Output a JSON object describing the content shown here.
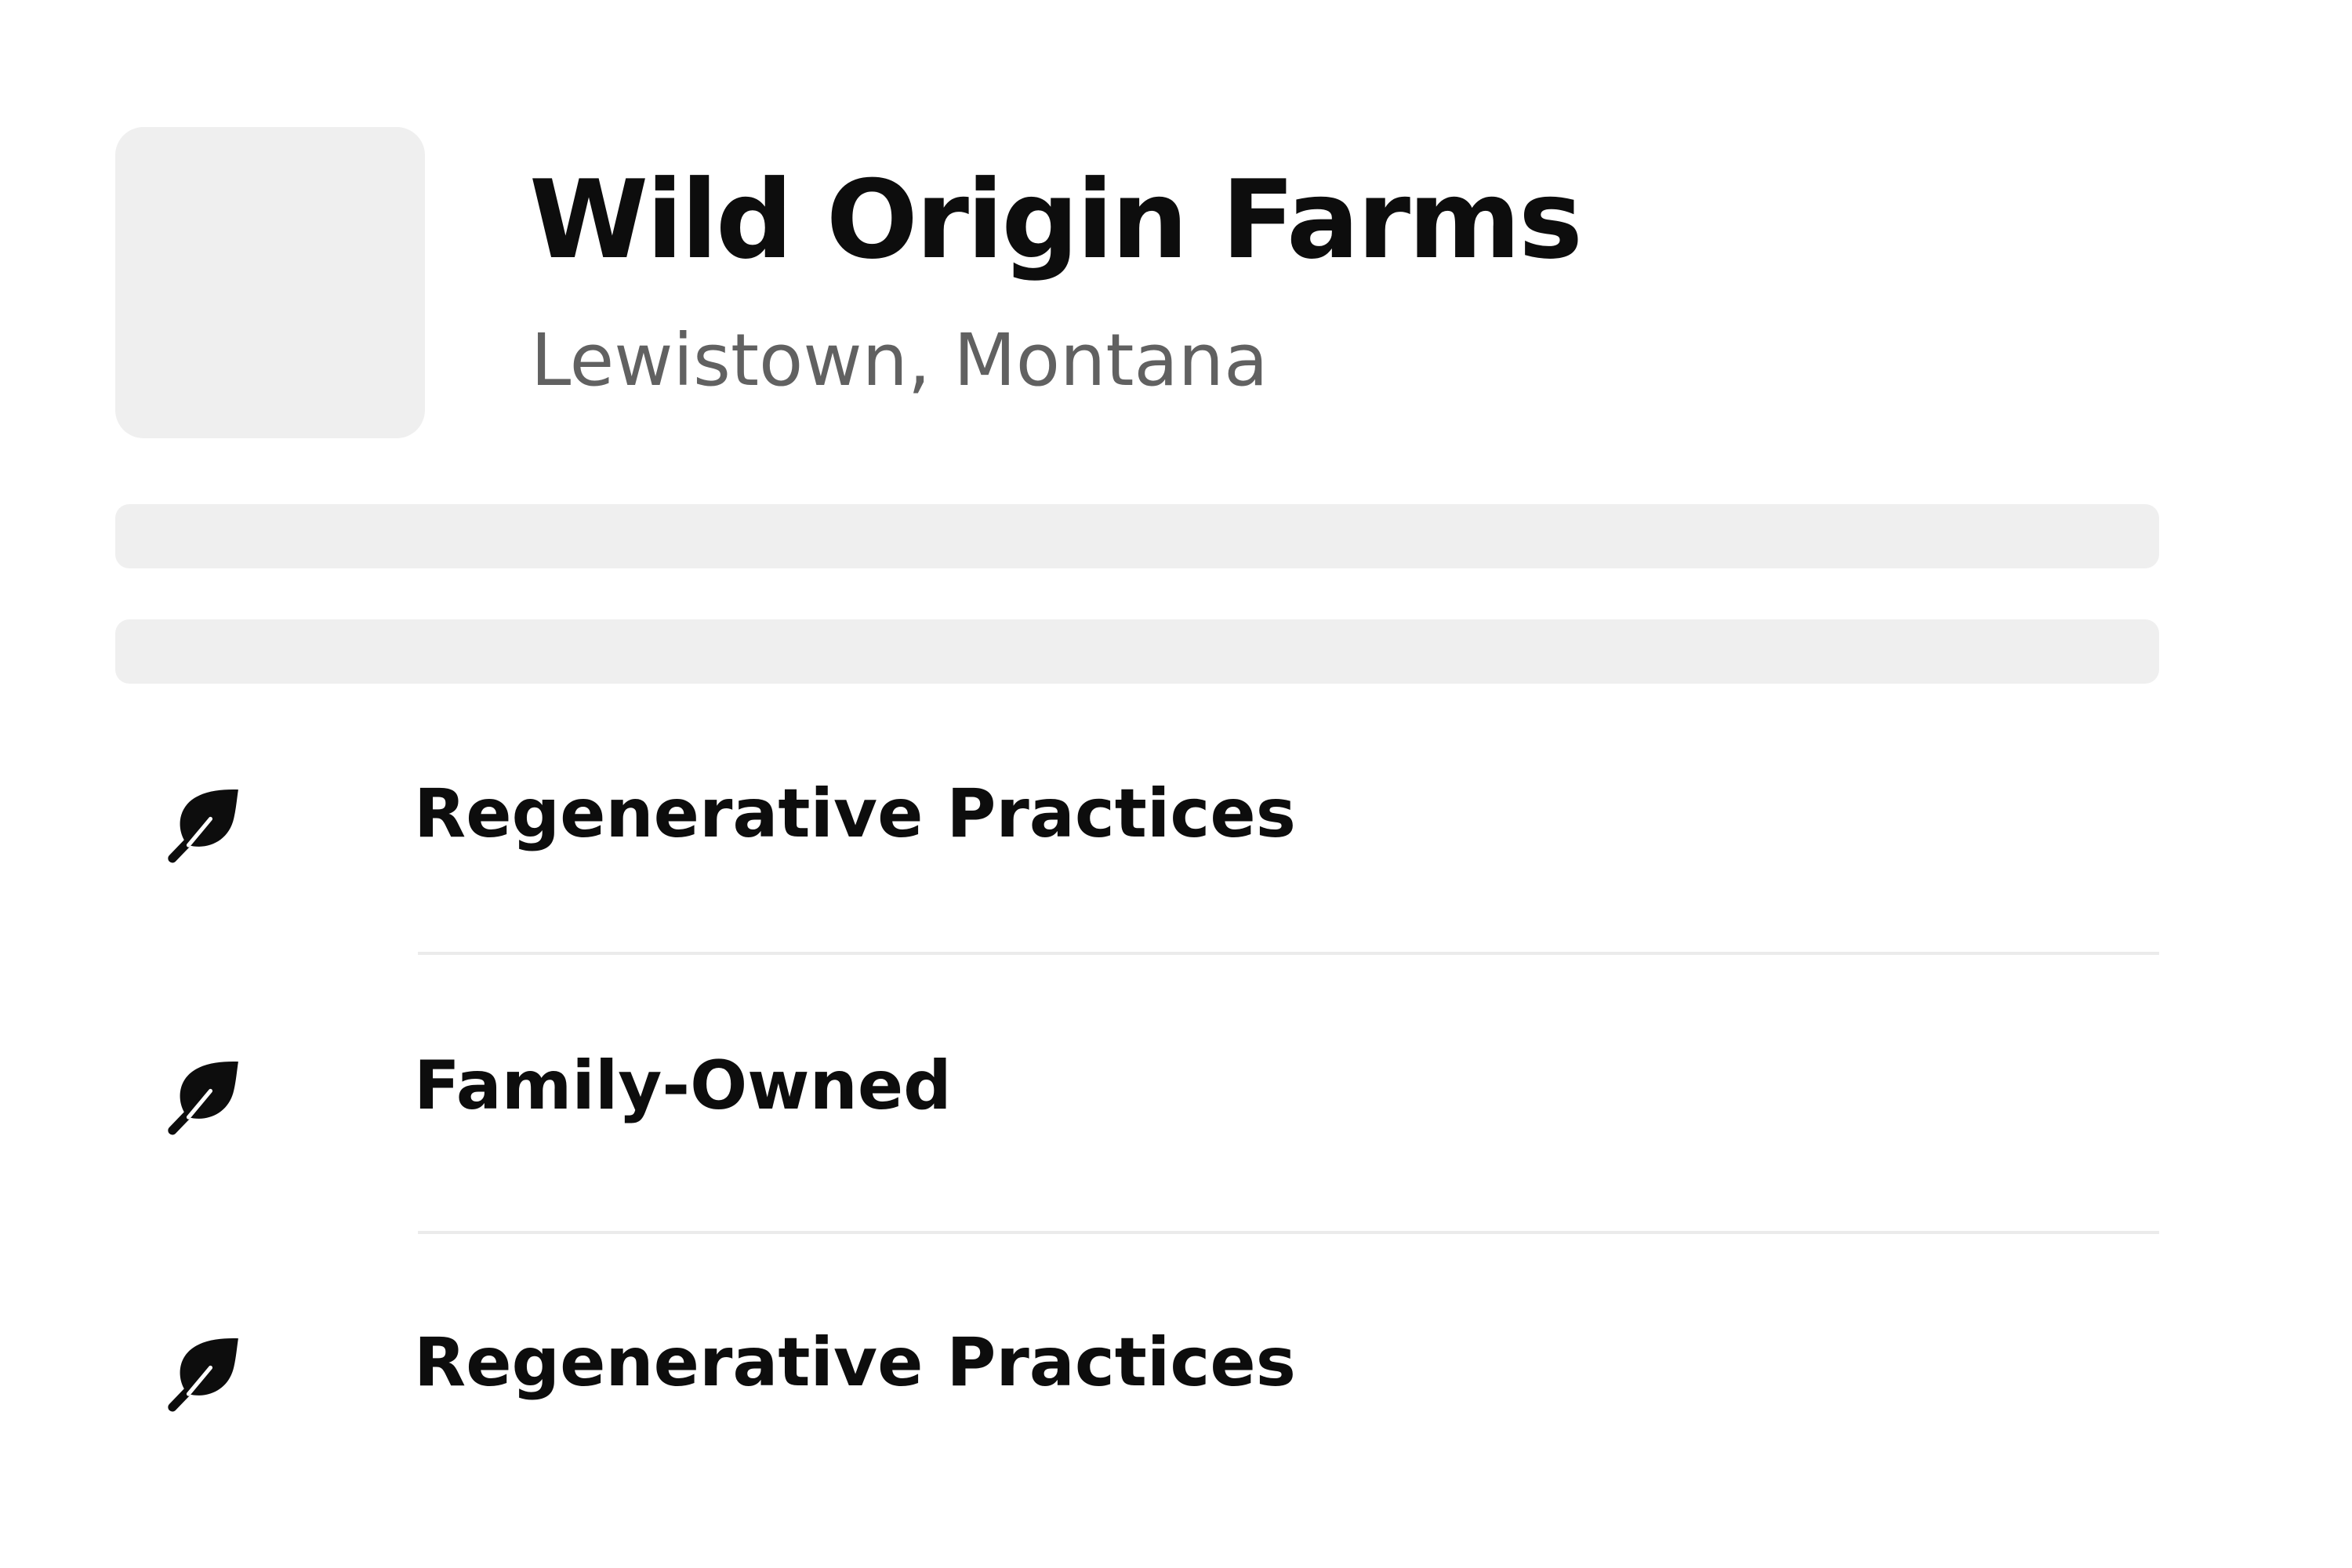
{
  "profile": {
    "name": "Wild Origin Farms",
    "location": "Lewistown, Montana",
    "avatar": {
      "icon": "placeholder-image"
    }
  },
  "placeholders": [
    {
      "kind": "text-line-skeleton"
    },
    {
      "kind": "text-line-skeleton"
    }
  ],
  "features": [
    {
      "icon": "leaf-icon",
      "label": "Regenerative Practices"
    },
    {
      "icon": "leaf-icon",
      "label": "Family-Owned"
    },
    {
      "icon": "leaf-icon",
      "label": "Regenerative Practices"
    }
  ],
  "colors": {
    "text_primary": "#0d0d0d",
    "text_secondary": "#616161",
    "skeleton": "#efefef",
    "divider": "#ebebeb",
    "background": "#ffffff"
  }
}
